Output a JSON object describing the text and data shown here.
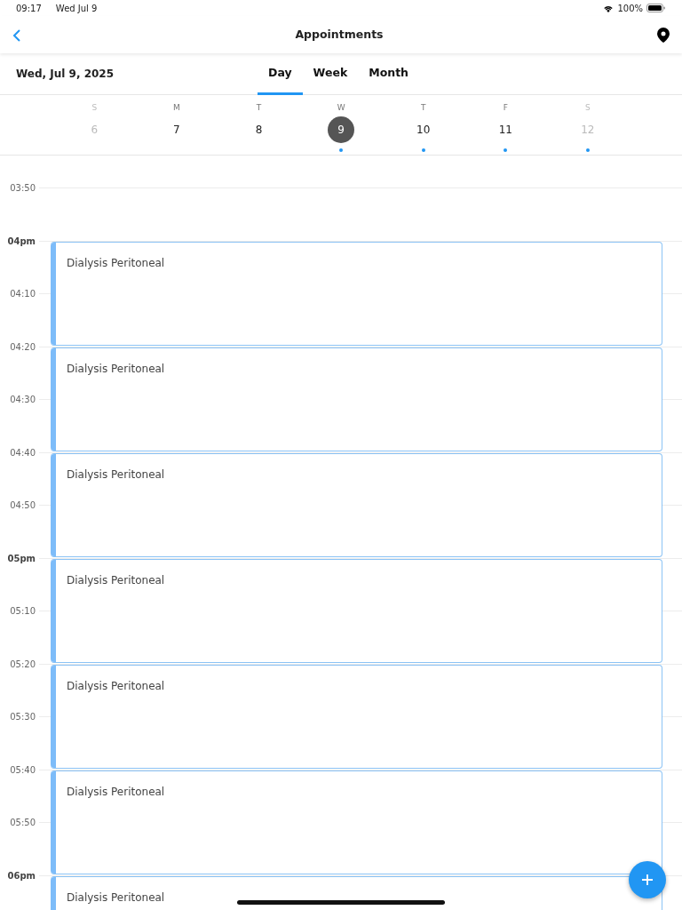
{
  "status_bar": {
    "time": "09:17",
    "date": "Wed Jul 9",
    "battery": "100%"
  },
  "nav": {
    "title": "Appointments"
  },
  "date_label": "Wed, Jul 9, 2025",
  "view_tabs": [
    {
      "label": "Day",
      "selected": true
    },
    {
      "label": "Week",
      "selected": false
    },
    {
      "label": "Month",
      "selected": false
    }
  ],
  "week": [
    {
      "weekday": "S",
      "day": "6",
      "dimmed": true,
      "selected": false,
      "has_events": false
    },
    {
      "weekday": "M",
      "day": "7",
      "dimmed": false,
      "selected": false,
      "has_events": false
    },
    {
      "weekday": "T",
      "day": "8",
      "dimmed": false,
      "selected": false,
      "has_events": false
    },
    {
      "weekday": "W",
      "day": "9",
      "dimmed": false,
      "selected": true,
      "has_events": true
    },
    {
      "weekday": "T",
      "day": "10",
      "dimmed": false,
      "selected": false,
      "has_events": true
    },
    {
      "weekday": "F",
      "day": "11",
      "dimmed": false,
      "selected": false,
      "has_events": true
    },
    {
      "weekday": "S",
      "day": "12",
      "dimmed": true,
      "selected": false,
      "has_events": true
    }
  ],
  "time_slots": [
    {
      "label": "03:50",
      "kind": "minute"
    },
    {
      "label": "04pm",
      "kind": "hour"
    },
    {
      "label": "04:10",
      "kind": "minute"
    },
    {
      "label": "04:20",
      "kind": "minute"
    },
    {
      "label": "04:30",
      "kind": "minute"
    },
    {
      "label": "04:40",
      "kind": "minute"
    },
    {
      "label": "04:50",
      "kind": "minute"
    },
    {
      "label": "05pm",
      "kind": "hour"
    },
    {
      "label": "05:10",
      "kind": "minute"
    },
    {
      "label": "05:20",
      "kind": "minute"
    },
    {
      "label": "05:30",
      "kind": "minute"
    },
    {
      "label": "05:40",
      "kind": "minute"
    },
    {
      "label": "05:50",
      "kind": "minute"
    },
    {
      "label": "06pm",
      "kind": "hour"
    }
  ],
  "appointments": [
    {
      "title": "Dialysis Peritoneal"
    },
    {
      "title": "Dialysis Peritoneal"
    },
    {
      "title": "Dialysis Peritoneal"
    },
    {
      "title": "Dialysis Peritoneal"
    },
    {
      "title": "Dialysis Peritoneal"
    },
    {
      "title": "Dialysis Peritoneal"
    },
    {
      "title": "Dialysis Peritoneal"
    }
  ]
}
